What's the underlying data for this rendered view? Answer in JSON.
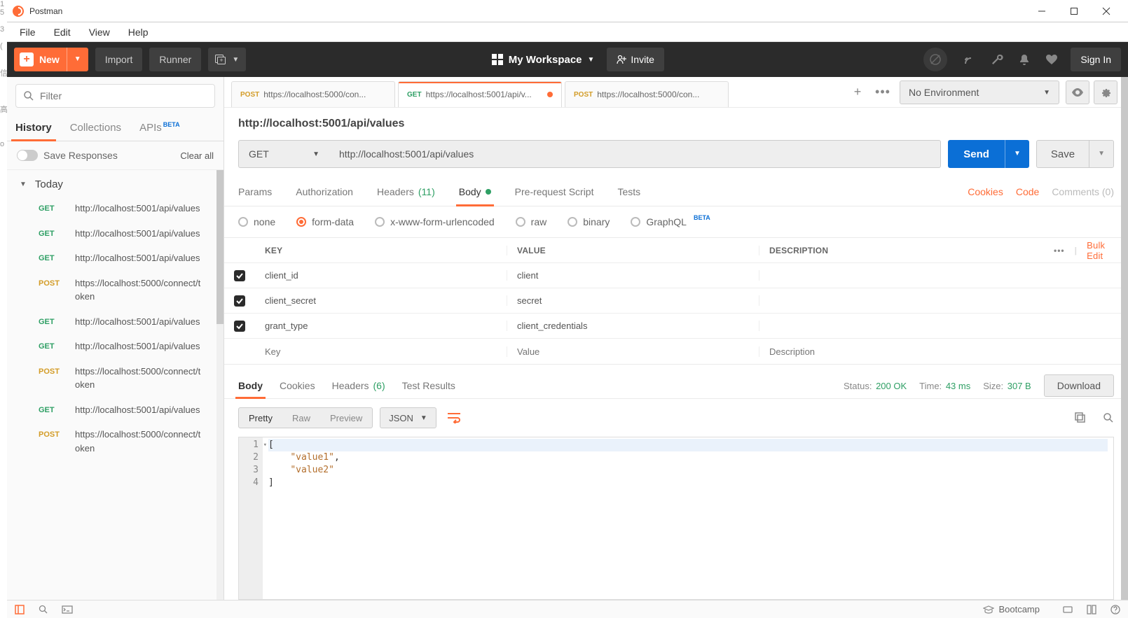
{
  "window": {
    "title": "Postman"
  },
  "menu": {
    "file": "File",
    "edit": "Edit",
    "view": "View",
    "help": "Help"
  },
  "toolbar": {
    "new": "New",
    "import": "Import",
    "runner": "Runner",
    "workspace": "My Workspace",
    "invite": "Invite",
    "signin": "Sign In"
  },
  "sidebar": {
    "filter_placeholder": "Filter",
    "tabs": {
      "history": "History",
      "collections": "Collections",
      "apis": "APIs",
      "beta": "BETA"
    },
    "save_responses": "Save Responses",
    "clear_all": "Clear all",
    "today": "Today",
    "items": [
      {
        "method": "GET",
        "url": "http://localhost:5001/api/values"
      },
      {
        "method": "GET",
        "url": "http://localhost:5001/api/values"
      },
      {
        "method": "GET",
        "url": "http://localhost:5001/api/values"
      },
      {
        "method": "POST",
        "url": "https://localhost:5000/connect/token"
      },
      {
        "method": "GET",
        "url": "http://localhost:5001/api/values"
      },
      {
        "method": "GET",
        "url": "http://localhost:5001/api/values"
      },
      {
        "method": "POST",
        "url": "https://localhost:5000/connect/token"
      },
      {
        "method": "GET",
        "url": "http://localhost:5001/api/values"
      },
      {
        "method": "POST",
        "url": "https://localhost:5000/connect/token"
      }
    ]
  },
  "tabs": [
    {
      "method": "POST",
      "title": "https://localhost:5000/con...",
      "active": false,
      "dirty": false
    },
    {
      "method": "GET",
      "title": "https://localhost:5001/api/v...",
      "active": true,
      "dirty": true
    },
    {
      "method": "POST",
      "title": "https://localhost:5000/con...",
      "active": false,
      "dirty": false
    }
  ],
  "env": {
    "selected": "No Environment"
  },
  "request": {
    "title": "http://localhost:5001/api/values",
    "method": "GET",
    "url": "http://localhost:5001/api/values",
    "send": "Send",
    "save": "Save",
    "subtabs": {
      "params": "Params",
      "authorization": "Authorization",
      "headers": "Headers",
      "headers_count": "(11)",
      "body": "Body",
      "prerequest": "Pre-request Script",
      "tests": "Tests",
      "cookies": "Cookies",
      "code": "Code",
      "comments": "Comments (0)"
    },
    "bodytypes": {
      "none": "none",
      "formdata": "form-data",
      "xwww": "x-www-form-urlencoded",
      "raw": "raw",
      "binary": "binary",
      "graphql": "GraphQL",
      "beta": "BETA"
    },
    "form": {
      "headers": {
        "key": "KEY",
        "value": "VALUE",
        "desc": "DESCRIPTION",
        "bulk": "Bulk Edit"
      },
      "rows": [
        {
          "key": "client_id",
          "value": "client",
          "desc": ""
        },
        {
          "key": "client_secret",
          "value": "secret",
          "desc": ""
        },
        {
          "key": "grant_type",
          "value": "client_credentials",
          "desc": ""
        }
      ],
      "placeholders": {
        "key": "Key",
        "value": "Value",
        "desc": "Description"
      }
    }
  },
  "response": {
    "tabs": {
      "body": "Body",
      "cookies": "Cookies",
      "headers": "Headers",
      "headers_count": "(6)",
      "tests": "Test Results"
    },
    "status_label": "Status:",
    "status": "200 OK",
    "time_label": "Time:",
    "time": "43 ms",
    "size_label": "Size:",
    "size": "307 B",
    "download": "Download",
    "view": {
      "pretty": "Pretty",
      "raw": "Raw",
      "preview": "Preview",
      "format": "JSON"
    },
    "lines": [
      "[",
      "    \"value1\",",
      "    \"value2\"",
      "]"
    ]
  },
  "status": {
    "bootcamp": "Bootcamp"
  }
}
